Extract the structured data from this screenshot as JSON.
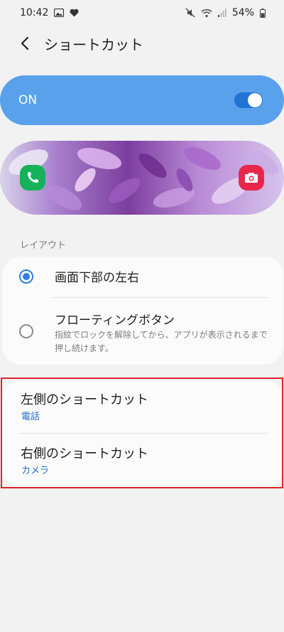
{
  "status_bar": {
    "time": "10:42",
    "battery": "54%"
  },
  "app_bar": {
    "title": "ショートカット"
  },
  "master_switch": {
    "label": "ON",
    "checked": true
  },
  "preview": {
    "left_icon": "phone-icon",
    "right_icon": "camera-icon"
  },
  "layout_section": {
    "header": "レイアウト",
    "options": [
      {
        "label": "画面下部の左右",
        "selected": true
      },
      {
        "label": "フローティングボタン",
        "description": "指紋でロックを解除してから、アプリが表示されるまで押し続けます。",
        "selected": false
      }
    ]
  },
  "shortcuts": [
    {
      "title": "左側のショートカット",
      "value": "電話"
    },
    {
      "title": "右側のショートカット",
      "value": "カメラ"
    }
  ],
  "colors": {
    "accent": "#2f7de2",
    "switch_bar": "#5aa1ec",
    "subtitle_blue": "#1f6fc9",
    "highlight_red": "#e0232d"
  }
}
